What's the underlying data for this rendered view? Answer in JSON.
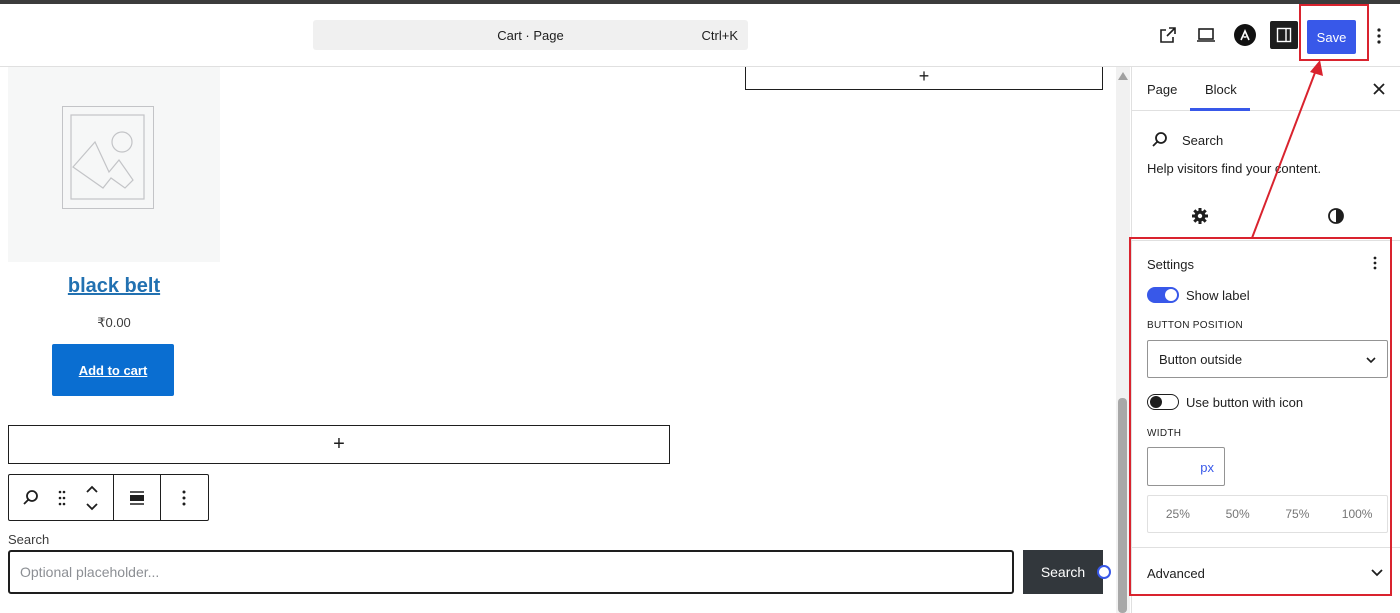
{
  "header": {
    "document_title": "Cart · Page",
    "shortcut": "Ctrl+K",
    "save_label": "Save",
    "icons": [
      "external-link-icon",
      "device-preview-icon",
      "astra-logo-icon",
      "sidebar-toggle-icon",
      "options-icon"
    ]
  },
  "canvas": {
    "product": {
      "title": "black belt",
      "price": "₹0.00",
      "add_to_cart_label": "Add to cart"
    },
    "appender_symbol": "+",
    "search_block": {
      "label": "Search",
      "placeholder": "Optional placeholder...",
      "button_label": "Search"
    }
  },
  "sidebar": {
    "tabs": [
      {
        "label": "Page",
        "active": false
      },
      {
        "label": "Block",
        "active": true
      }
    ],
    "block_card": {
      "title": "Search",
      "description": "Help visitors find your content."
    },
    "settings": {
      "title": "Settings",
      "show_label": {
        "label": "Show label",
        "enabled": true
      },
      "button_position": {
        "caption": "BUTTON POSITION",
        "value": "Button outside"
      },
      "use_icon": {
        "label": "Use button with icon",
        "enabled": false
      },
      "width": {
        "caption": "WIDTH",
        "unit": "px",
        "value": ""
      },
      "percent_options": [
        "25%",
        "50%",
        "75%",
        "100%"
      ]
    },
    "advanced_title": "Advanced"
  },
  "colors": {
    "accent": "#3858e9",
    "annotation": "#d9232e",
    "add_to_cart": "#0a6ed1",
    "search_button": "#32373c"
  }
}
